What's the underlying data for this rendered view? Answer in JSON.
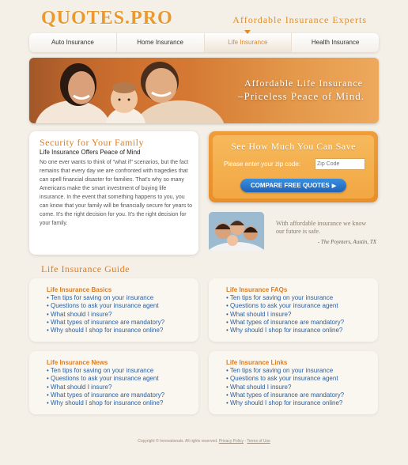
{
  "header": {
    "logo": "QUOTES.PRO",
    "tagline": "Affordable Insurance Experts"
  },
  "nav": {
    "items": [
      {
        "label": "Auto Insurance"
      },
      {
        "label": "Home Insurance"
      },
      {
        "label": "Life Insurance"
      },
      {
        "label": "Health Insurance"
      }
    ],
    "active": "Life Insurance"
  },
  "hero": {
    "line1": "Affordable Life Insurance",
    "line2": "–Priceless Peace of Mind."
  },
  "security": {
    "title": "Security for Your Family",
    "subtitle": "Life Insurance Offers Peace of Mind",
    "body": "No one ever wants to think of \"what if\" scenarios, but the fact remains that every day we are confronted with tragedies that can spell financial disaster for families. That's why so many Americans make the smart investment of buying life insurance. In the event that something happens to you, you can know that your family will be financially secure for years to come. It's the right decision for you. It's the right decision for your family."
  },
  "quote": {
    "title": "See How Much You Can Save",
    "zip_label": "Please enter your zip code:",
    "zip_placeholder": "Zip Code",
    "button_label": "COMPARE FREE QUOTES",
    "button_arrow": "▶"
  },
  "testimonial": {
    "text": "With affordable insurance we know our future is safe.",
    "author": "- The Poynters, Austin, TX"
  },
  "guide": {
    "title": "Life Insurance Guide",
    "cards": [
      {
        "title": "Life Insurance Basics",
        "links": [
          "Ten tips for saving on your insurance",
          "Questions to ask your insurance agent",
          "What should I insure?",
          "What types of insurance are mandatory?",
          "Why should I shop for insurance online?"
        ]
      },
      {
        "title": "Life Insurance FAQs",
        "links": [
          "Ten tips for saving on your insurance",
          "Questions to ask your insurance agent",
          "What should I insure?",
          "What types of insurance are mandatory?",
          "Why should I shop for insurance online?"
        ]
      },
      {
        "title": "Life Insurance News",
        "links": [
          "Ten tips for saving on your insurance",
          "Questions to ask your insurance agent",
          "What should I insure?",
          "What types of insurance are mandatory?",
          "Why should I shop for insurance online?"
        ]
      },
      {
        "title": "Life Insurance Links",
        "links": [
          "Ten tips for saving on your insurance",
          "Questions to ask your insurance agent",
          "What should I insure?",
          "What types of insurance are mandatory?",
          "Why should I shop for insurance online?"
        ]
      }
    ]
  },
  "footer": {
    "copyright": "Copyright © Innovationals. All rights reserved.",
    "privacy": "Privacy Policy",
    "separator": "-",
    "terms": "Terms of Use"
  },
  "colors": {
    "accent": "#e07c1e",
    "link": "#2a5f9e",
    "button": "#1f63b8",
    "background": "#f4efe7"
  }
}
